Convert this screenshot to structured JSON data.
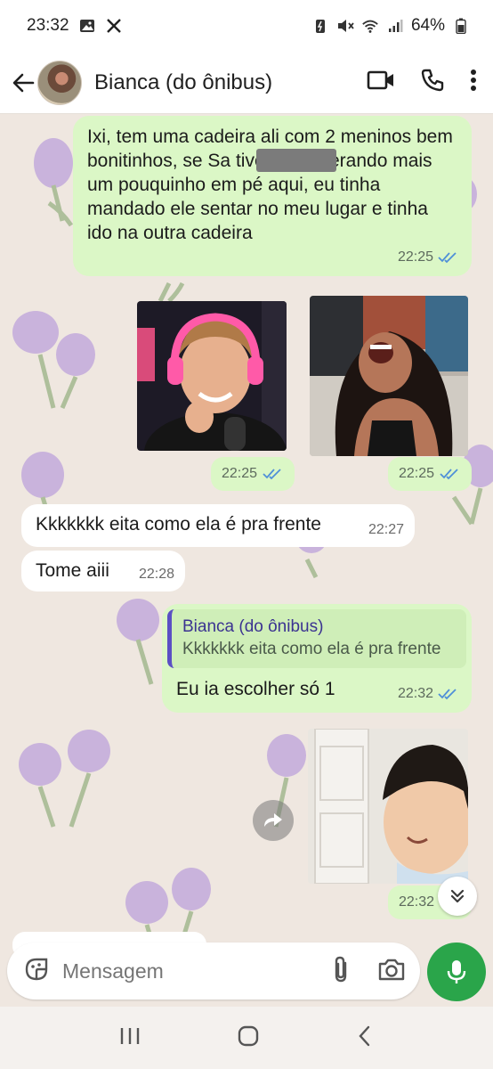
{
  "status_bar": {
    "time": "23:32",
    "battery": "64%"
  },
  "header": {
    "contact_name": "Bianca (do ônibus)"
  },
  "messages": [
    {
      "type": "text",
      "direction": "outgoing",
      "text": "Ixi, tem uma cadeira ali com 2 meninos bem bonitinhos, se Sa      tivesse esperando mais um pouquinho em pé aqui, eu tinha mandado ele sentar no meu lugar e tinha ido na outra cadeira",
      "time": "22:25",
      "read": true
    },
    {
      "type": "image",
      "direction": "outgoing",
      "description_icon": "photo-person-headphones",
      "time": "22:25",
      "read": true
    },
    {
      "type": "image",
      "direction": "outgoing",
      "description_icon": "photo-girl-laughing",
      "time": "22:25",
      "read": true
    },
    {
      "type": "text",
      "direction": "incoming",
      "text": "Kkkkkkk eita como ela é pra frente",
      "time": "22:27"
    },
    {
      "type": "text",
      "direction": "incoming",
      "text": "Tome aiii",
      "time": "22:28"
    },
    {
      "type": "reply",
      "direction": "outgoing",
      "quote_name": "Bianca (do ônibus)",
      "quote_text": "Kkkkkkk eita como ela é pra frente",
      "text": "Eu ia escolher só 1",
      "time": "22:32",
      "read": true
    },
    {
      "type": "image",
      "direction": "outgoing",
      "description_icon": "photo-child-smiling",
      "time": "22:32",
      "read": true
    }
  ],
  "composer": {
    "placeholder": "Mensagem"
  },
  "colors": {
    "outgoing_bubble": "#dbf7c6",
    "incoming_bubble": "#ffffff",
    "read_ticks": "#4f8fd8",
    "mic_button": "#2aa54a",
    "quote_bar": "#5b4fc4"
  }
}
